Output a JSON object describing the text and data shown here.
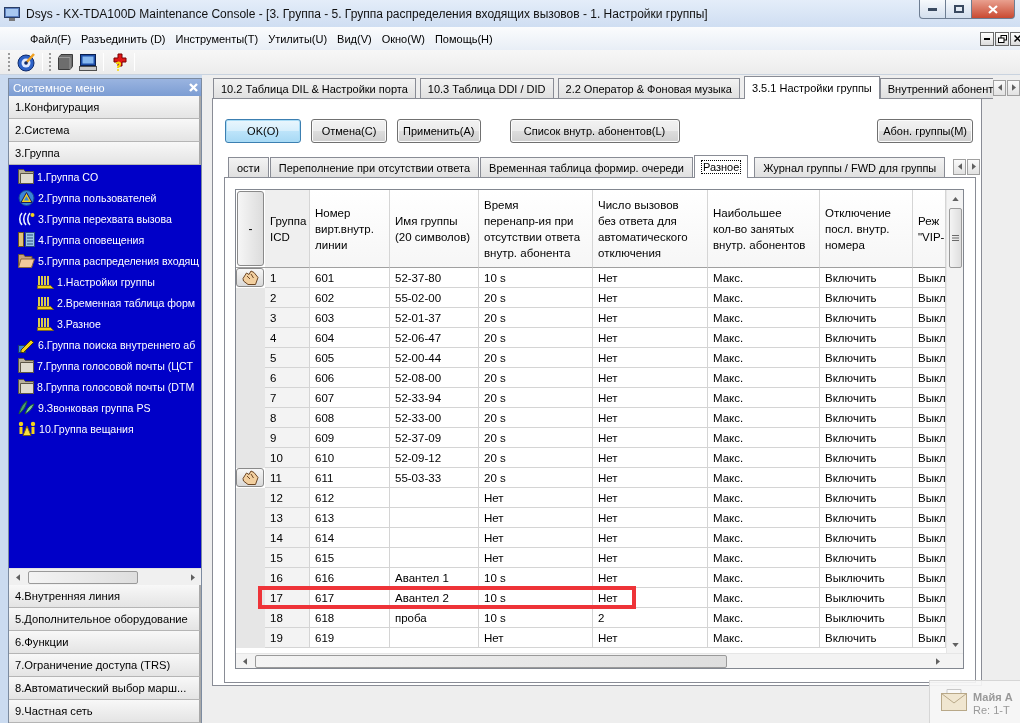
{
  "window": {
    "title": "Dsys - KX-TDA100D Maintenance Console - [3. Группа - 5. Группа распределения входящих вызовов - 1. Настройки группы]"
  },
  "menu": [
    "Файл(F)",
    "Разъединить (D)",
    "Инструменты(T)",
    "Утилиты(U)",
    "Вид(V)",
    "Окно(W)",
    "Помощь(H)"
  ],
  "sidebar": {
    "title": "Системное меню",
    "sections": [
      {
        "label": "1.Конфигурация"
      },
      {
        "label": "2.Система"
      },
      {
        "label": "3.Группа",
        "items": [
          {
            "label": "1.Группа CO",
            "kind": "folder",
            "expanded": false
          },
          {
            "label": "2.Группа пользователей",
            "kind": "user-group"
          },
          {
            "label": "3.Группа перехвата вызова",
            "kind": "pickup-group"
          },
          {
            "label": "4.Группа оповещения",
            "kind": "paging-group"
          },
          {
            "label": "5.Группа распределения входящ",
            "kind": "folder",
            "expanded": true,
            "children": [
              {
                "label": "1.Настройки группы",
                "kind": "table"
              },
              {
                "label": "2.Временная таблица форм",
                "kind": "table"
              },
              {
                "label": "3.Разное",
                "kind": "table"
              }
            ]
          },
          {
            "label": "6.Группа поиска внутреннего аб",
            "kind": "hunt-group"
          },
          {
            "label": "7.Группа голосовой почты (ЦСТ",
            "kind": "folder",
            "expanded": false
          },
          {
            "label": "8.Группа голосовой почты (DTM",
            "kind": "folder",
            "expanded": false
          },
          {
            "label": "9.Звонковая группа PS",
            "kind": "ring-group"
          },
          {
            "label": "10.Группа вещания",
            "kind": "broadcast-group"
          }
        ]
      },
      {
        "label": "4.Внутренняя линия"
      },
      {
        "label": "5.Дополнительное оборудование"
      },
      {
        "label": "6.Функции"
      },
      {
        "label": "7.Ограничение доступа (TRS)"
      },
      {
        "label": "8.Автоматический выбор марш..."
      },
      {
        "label": "9.Частная сеть"
      }
    ]
  },
  "tabs": [
    {
      "label": "10.2 Таблица DIL & Настройки порта",
      "selected": false
    },
    {
      "label": "10.3 Таблица DDI / DID",
      "selected": false
    },
    {
      "label": "2.2 Оператор & Фоновая музыка",
      "selected": false
    },
    {
      "label": "3.5.1 Настройки группы",
      "selected": true
    },
    {
      "label": "Внутренний абонент",
      "selected": false
    }
  ],
  "form_buttons": [
    {
      "label": "OK(O)",
      "focused": true
    },
    {
      "label": "Отмена(C)",
      "focused": false
    },
    {
      "label": "Применить(A)",
      "focused": false
    }
  ],
  "list_button": "Список внутр. абонентов(L)",
  "group_button": "Абон. группы(M)",
  "subtabs": [
    {
      "label": "ости",
      "selected": false
    },
    {
      "label": "Переполнение при отсутствии ответа",
      "selected": false
    },
    {
      "label": "Временная таблица формир. очереди",
      "selected": false
    },
    {
      "label": "Разное",
      "selected": true
    },
    {
      "label": "Журнал группы / FWD для группы",
      "selected": false
    }
  ],
  "table": {
    "corner_button": "-",
    "columns": [
      {
        "header": "Группа\nICD"
      },
      {
        "header": "Номер\nвирт.внутр.\nлинии"
      },
      {
        "header": "Имя группы\n(20 символов)"
      },
      {
        "header": "Время\nперенапр-ия при\nотсутствии ответа\nвнутр. абонента"
      },
      {
        "header": "Число вызовов\nбез ответа для\nавтоматического\nотключения"
      },
      {
        "header": "Наибольшее\nкол-во занятых\nвнутр. абонентов"
      },
      {
        "header": "Отключение\nпосл. внутр.\nномера"
      },
      {
        "header": "Реж\n\"VIP-"
      }
    ],
    "rows": [
      {
        "icd": "1",
        "ext_number": "601",
        "name": "52-37-80",
        "redirect_time": "10 s",
        "unanswered_calls": "Нет",
        "max_busy": "Макс.",
        "last_ext_disconnect": "Включить",
        "column_8": "Выкл",
        "marked": true,
        "annotated": false
      },
      {
        "icd": "2",
        "ext_number": "602",
        "name": "55-02-00",
        "redirect_time": "20 s",
        "unanswered_calls": "Нет",
        "max_busy": "Макс.",
        "last_ext_disconnect": "Включить",
        "column_8": "Выкл",
        "marked": false,
        "annotated": false
      },
      {
        "icd": "3",
        "ext_number": "603",
        "name": "52-01-37",
        "redirect_time": "20 s",
        "unanswered_calls": "Нет",
        "max_busy": "Макс.",
        "last_ext_disconnect": "Включить",
        "column_8": "Выкл",
        "marked": false,
        "annotated": false
      },
      {
        "icd": "4",
        "ext_number": "604",
        "name": "52-06-47",
        "redirect_time": "20 s",
        "unanswered_calls": "Нет",
        "max_busy": "Макс.",
        "last_ext_disconnect": "Включить",
        "column_8": "Выкл",
        "marked": false,
        "annotated": false
      },
      {
        "icd": "5",
        "ext_number": "605",
        "name": "52-00-44",
        "redirect_time": "20 s",
        "unanswered_calls": "Нет",
        "max_busy": "Макс.",
        "last_ext_disconnect": "Включить",
        "column_8": "Выкл",
        "marked": false,
        "annotated": false
      },
      {
        "icd": "6",
        "ext_number": "606",
        "name": "52-08-00",
        "redirect_time": "20 s",
        "unanswered_calls": "Нет",
        "max_busy": "Макс.",
        "last_ext_disconnect": "Включить",
        "column_8": "Выкл",
        "marked": false,
        "annotated": false
      },
      {
        "icd": "7",
        "ext_number": "607",
        "name": "52-33-94",
        "redirect_time": "20 s",
        "unanswered_calls": "Нет",
        "max_busy": "Макс.",
        "last_ext_disconnect": "Включить",
        "column_8": "Выкл",
        "marked": false,
        "annotated": false
      },
      {
        "icd": "8",
        "ext_number": "608",
        "name": "52-33-00",
        "redirect_time": "20 s",
        "unanswered_calls": "Нет",
        "max_busy": "Макс.",
        "last_ext_disconnect": "Включить",
        "column_8": "Выкл",
        "marked": false,
        "annotated": false
      },
      {
        "icd": "9",
        "ext_number": "609",
        "name": "52-37-09",
        "redirect_time": "20 s",
        "unanswered_calls": "Нет",
        "max_busy": "Макс.",
        "last_ext_disconnect": "Включить",
        "column_8": "Выкл",
        "marked": false,
        "annotated": false
      },
      {
        "icd": "10",
        "ext_number": "610",
        "name": "52-09-12",
        "redirect_time": "20 s",
        "unanswered_calls": "Нет",
        "max_busy": "Макс.",
        "last_ext_disconnect": "Включить",
        "column_8": "Выкл",
        "marked": false,
        "annotated": false
      },
      {
        "icd": "11",
        "ext_number": "611",
        "name": "55-03-33",
        "redirect_time": "20 s",
        "unanswered_calls": "Нет",
        "max_busy": "Макс.",
        "last_ext_disconnect": "Включить",
        "column_8": "Выкл",
        "marked": true,
        "annotated": false
      },
      {
        "icd": "12",
        "ext_number": "612",
        "redirect_time": "Нет",
        "unanswered_calls": "Нет",
        "max_busy": "Макс.",
        "last_ext_disconnect": "Включить",
        "column_8": "Выкл",
        "marked": false,
        "annotated": false
      },
      {
        "icd": "13",
        "ext_number": "613",
        "redirect_time": "Нет",
        "unanswered_calls": "Нет",
        "max_busy": "Макс.",
        "last_ext_disconnect": "Включить",
        "column_8": "Выкл",
        "marked": false,
        "annotated": false
      },
      {
        "icd": "14",
        "ext_number": "614",
        "redirect_time": "Нет",
        "unanswered_calls": "Нет",
        "max_busy": "Макс.",
        "last_ext_disconnect": "Включить",
        "column_8": "Выкл",
        "marked": false,
        "annotated": false
      },
      {
        "icd": "15",
        "ext_number": "615",
        "redirect_time": "Нет",
        "unanswered_calls": "Нет",
        "max_busy": "Макс.",
        "last_ext_disconnect": "Включить",
        "column_8": "Выкл",
        "marked": false,
        "annotated": false
      },
      {
        "icd": "16",
        "ext_number": "616",
        "name": "Авантел 1",
        "redirect_time": "10 s",
        "unanswered_calls": "Нет",
        "max_busy": "Макс.",
        "last_ext_disconnect": "Выключить",
        "column_8": "Выкл",
        "marked": false,
        "annotated": false
      },
      {
        "icd": "17",
        "ext_number": "617",
        "name": "Авантел 2",
        "redirect_time": "10 s",
        "unanswered_calls": "Нет",
        "max_busy": "Макс.",
        "last_ext_disconnect": "Выключить",
        "column_8": "Выкл",
        "marked": false,
        "annotated": true
      },
      {
        "icd": "18",
        "ext_number": "618",
        "name": "проба",
        "redirect_time": "10 s",
        "unanswered_calls": "2",
        "max_busy": "Макс.",
        "last_ext_disconnect": "Выключить",
        "column_8": "Выкл",
        "marked": false,
        "annotated": false
      },
      {
        "icd": "19",
        "ext_number": "619",
        "redirect_time": "Нет",
        "unanswered_calls": "Нет",
        "max_busy": "Макс.",
        "last_ext_disconnect": "Включить",
        "column_8": "Выкл",
        "marked": false,
        "annotated": false
      }
    ]
  },
  "notification": {
    "sender": "Майя А",
    "subject": "Re: 1-Т"
  }
}
